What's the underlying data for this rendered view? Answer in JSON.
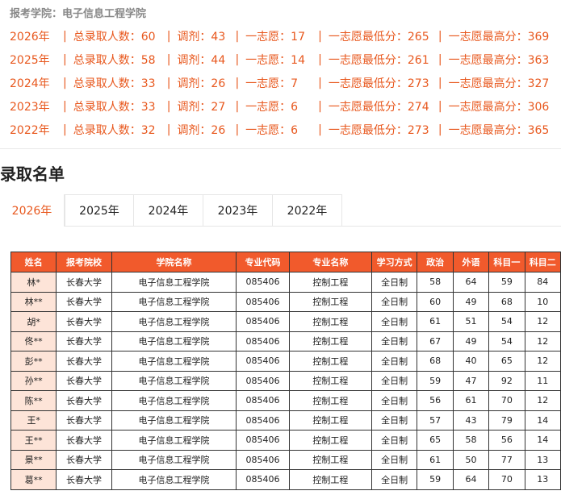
{
  "college_label": "报考学院：电子信息工程学院",
  "stats": [
    {
      "year": "2026年",
      "total": "总录取人数：60",
      "adjust": "调剂：43",
      "first": "一志愿：17",
      "min": "一志愿最低分：265",
      "max": "一志愿最高分：369"
    },
    {
      "year": "2025年",
      "total": "总录取人数：58",
      "adjust": "调剂：44",
      "first": "一志愿：14",
      "min": "一志愿最低分：261",
      "max": "一志愿最高分：363"
    },
    {
      "year": "2024年",
      "total": "总录取人数：33",
      "adjust": "调剂：26",
      "first": "一志愿：7",
      "min": "一志愿最低分：273",
      "max": "一志愿最高分：327"
    },
    {
      "year": "2023年",
      "total": "总录取人数：33",
      "adjust": "调剂：27",
      "first": "一志愿：6",
      "min": "一志愿最低分：274",
      "max": "一志愿最高分：306"
    },
    {
      "year": "2022年",
      "total": "总录取人数：32",
      "adjust": "调剂：26",
      "first": "一志愿：6",
      "min": "一志愿最低分：273",
      "max": "一志愿最高分：365"
    }
  ],
  "section_title": "录取名单",
  "tabs": [
    "2026年",
    "2025年",
    "2024年",
    "2023年",
    "2022年"
  ],
  "table": {
    "headers": [
      "姓名",
      "报考院校",
      "学院名称",
      "专业代码",
      "专业名称",
      "学习方式",
      "政治",
      "外语",
      "科目一",
      "科目二"
    ],
    "rows": [
      [
        "林*",
        "长春大学",
        "电子信息工程学院",
        "085406",
        "控制工程",
        "全日制",
        "58",
        "64",
        "59",
        "84"
      ],
      [
        "林**",
        "长春大学",
        "电子信息工程学院",
        "085406",
        "控制工程",
        "全日制",
        "60",
        "49",
        "68",
        "10"
      ],
      [
        "胡*",
        "长春大学",
        "电子信息工程学院",
        "085406",
        "控制工程",
        "全日制",
        "61",
        "51",
        "54",
        "12"
      ],
      [
        "佟**",
        "长春大学",
        "电子信息工程学院",
        "085406",
        "控制工程",
        "全日制",
        "67",
        "49",
        "54",
        "12"
      ],
      [
        "彭**",
        "长春大学",
        "电子信息工程学院",
        "085406",
        "控制工程",
        "全日制",
        "68",
        "40",
        "65",
        "12"
      ],
      [
        "孙**",
        "长春大学",
        "电子信息工程学院",
        "085406",
        "控制工程",
        "全日制",
        "59",
        "47",
        "92",
        "11"
      ],
      [
        "陈**",
        "长春大学",
        "电子信息工程学院",
        "085406",
        "控制工程",
        "全日制",
        "56",
        "61",
        "70",
        "12"
      ],
      [
        "王*",
        "长春大学",
        "电子信息工程学院",
        "085406",
        "控制工程",
        "全日制",
        "57",
        "43",
        "79",
        "14"
      ],
      [
        "王**",
        "长春大学",
        "电子信息工程学院",
        "085406",
        "控制工程",
        "全日制",
        "65",
        "58",
        "56",
        "14"
      ],
      [
        "景**",
        "长春大学",
        "电子信息工程学院",
        "085406",
        "控制工程",
        "全日制",
        "61",
        "50",
        "77",
        "13"
      ],
      [
        "葛**",
        "长春大学",
        "电子信息工程学院",
        "085406",
        "控制工程",
        "全日制",
        "59",
        "64",
        "70",
        "13"
      ]
    ]
  }
}
